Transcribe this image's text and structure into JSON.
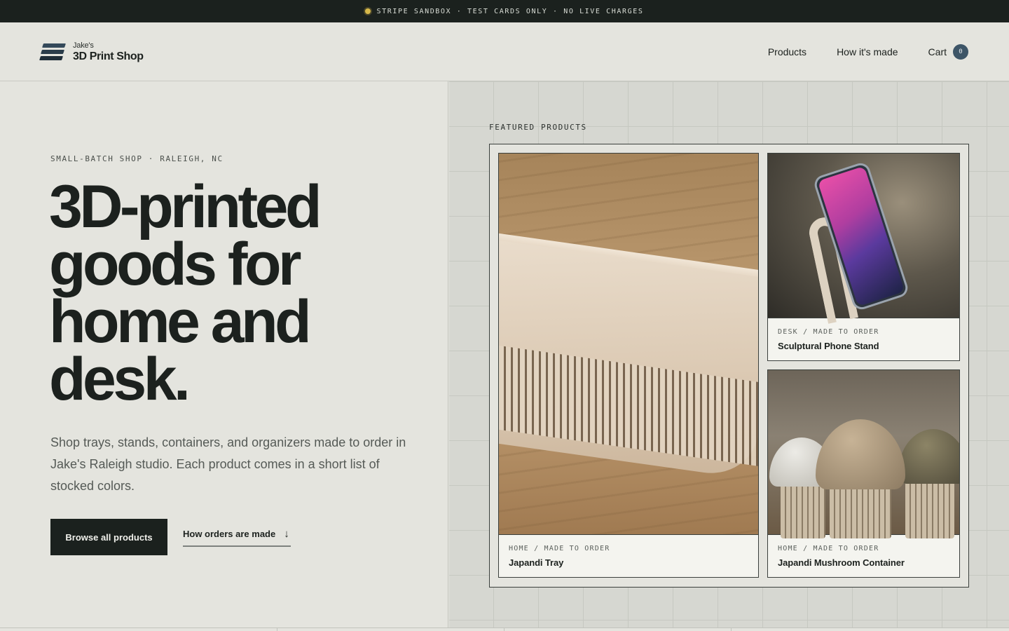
{
  "banner": {
    "text": "STRIPE SANDBOX · TEST CARDS ONLY · NO LIVE CHARGES",
    "dot_color": "#d6b84a"
  },
  "header": {
    "logo_small": "Jake's",
    "logo_big": "3D Print Shop",
    "nav": [
      {
        "label": "Products"
      },
      {
        "label": "How it's made"
      }
    ],
    "cart": {
      "label": "Cart",
      "count": "0"
    }
  },
  "hero": {
    "eyebrow": "SMALL-BATCH SHOP · RALEIGH, NC",
    "headline": "3D-printed goods for home and desk.",
    "lede": "Shop trays, stands, containers, and organizers made to order in Jake's Raleigh studio. Each product comes in a short list of stocked colors.",
    "primary_cta": "Browse all products",
    "secondary_cta": "How orders are made"
  },
  "featured": {
    "label": "FEATURED PRODUCTS",
    "products": [
      {
        "category": "HOME / MADE TO ORDER",
        "name": "Japandi Tray"
      },
      {
        "category": "DESK / MADE TO ORDER",
        "name": "Sculptural Phone Stand"
      },
      {
        "category": "HOME / MADE TO ORDER",
        "name": "Japandi Mushroom Container"
      }
    ]
  },
  "colors": {
    "accent": "#1b211e",
    "cart_badge": "#3d5567",
    "background": "#e4e4de"
  }
}
